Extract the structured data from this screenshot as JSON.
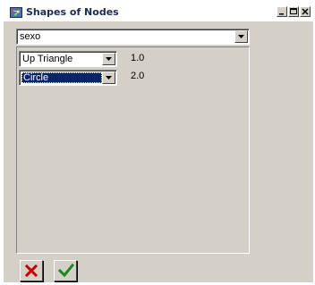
{
  "window": {
    "title": "Shapes of Nodes"
  },
  "attribute_select": {
    "selected": "sexo"
  },
  "shape_rows": [
    {
      "shape": "Up Triangle",
      "value": "1.0",
      "focused": false
    },
    {
      "shape": "Circle",
      "value": "2.0",
      "focused": true
    }
  ],
  "buttons": {
    "cancel_icon": "red-x-icon",
    "ok_icon": "green-check-icon"
  },
  "colors": {
    "window_bg": "#d4d0c8",
    "selection": "#0a246a",
    "cancel": "#cc0000",
    "ok": "#1a8a1a"
  }
}
